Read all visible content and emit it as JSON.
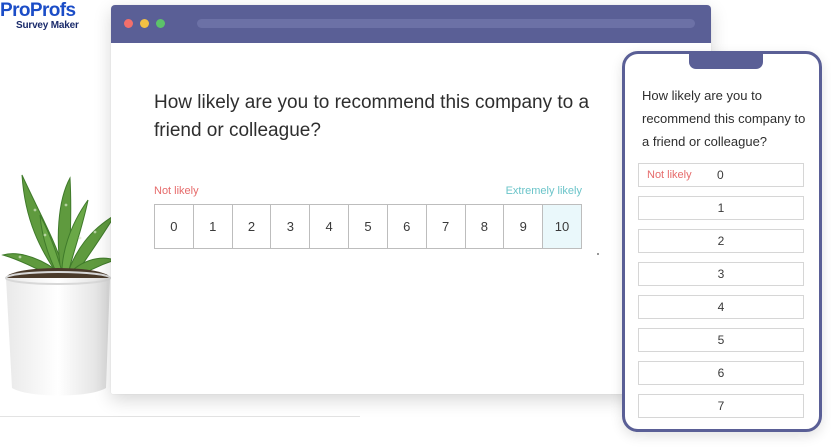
{
  "logo": {
    "main_pro": "Pro",
    "main_profs": "Profs",
    "sub": "Survey Maker"
  },
  "browser": {
    "question": "How likely are you to recommend this company to a friend or colleague?",
    "label_low": "Not likely",
    "label_high": "Extremely likely",
    "scale": [
      "0",
      "1",
      "2",
      "3",
      "4",
      "5",
      "6",
      "7",
      "8",
      "9",
      "10"
    ],
    "highlighted_value": "10"
  },
  "phone": {
    "question": "How likely are you to recommend this company to a friend or colleague?",
    "label_low": "Not likely",
    "options": [
      "0",
      "1",
      "2",
      "3",
      "4",
      "5",
      "6",
      "7"
    ]
  },
  "colors": {
    "window_bar": "#5a5f96",
    "label_low": "#e66b6b",
    "label_high": "#6bc4c9",
    "brand_blue": "#1b4dc7"
  }
}
